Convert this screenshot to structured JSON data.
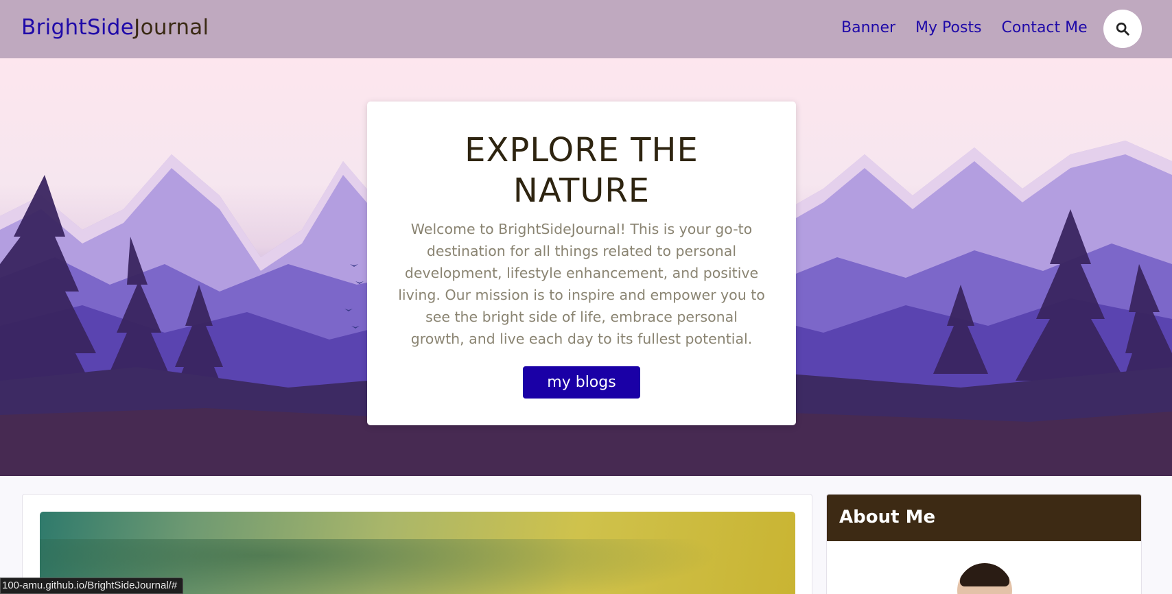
{
  "header": {
    "brand_part1": "BrightSide",
    "brand_part2": "Journal",
    "nav": [
      "Banner",
      "My Posts",
      "Contact Me"
    ],
    "search_icon": "search-icon"
  },
  "hero": {
    "title_line1": "EXPLORE THE",
    "title_line2": "NATURE",
    "text": "Welcome to BrightSideJournal! This is your go-to destination for all things related to personal development, lifestyle enhancement, and positive living. Our mission is to inspire and empower you to see the bright side of life, embrace personal growth, and live each day to its fullest potential.",
    "button_label": "my blogs"
  },
  "sidebar": {
    "about_title": "About Me"
  },
  "status_bar": {
    "url": "100-amu.github.io/BrightSideJournal/#"
  },
  "colors": {
    "navbar": "#bfa9bf",
    "brand_primary": "#1f0aa8",
    "brand_secondary": "#3a2a14",
    "button": "#1a00a6",
    "about_header": "#3d2a14"
  }
}
